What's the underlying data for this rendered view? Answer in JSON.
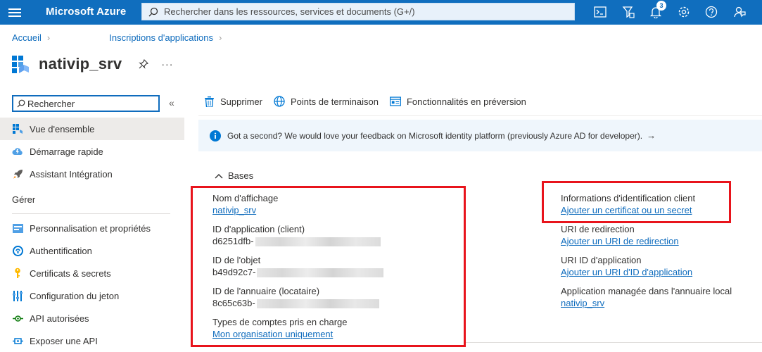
{
  "topbar": {
    "brand": "Microsoft Azure",
    "search_placeholder": "Rechercher dans les ressources, services et documents (G+/)",
    "notification_count": "3",
    "icons": [
      "cloud-shell-icon",
      "directory-filter-icon",
      "notifications-icon",
      "settings-icon",
      "help-icon",
      "feedback-icon"
    ]
  },
  "breadcrumb": {
    "home": "Accueil",
    "parent": "Inscriptions d'applications"
  },
  "header": {
    "title": "nativip_srv",
    "more": "···"
  },
  "sidebar": {
    "search_placeholder": "Rechercher",
    "collapse": "«",
    "items": [
      {
        "label": "Vue d'ensemble",
        "icon": "overview-grid-icon"
      },
      {
        "label": "Démarrage rapide",
        "icon": "quickstart-cloud-icon"
      },
      {
        "label": "Assistant Intégration",
        "icon": "rocket-icon"
      }
    ],
    "section_label": "Gérer",
    "manage_items": [
      {
        "label": "Personnalisation et propriétés",
        "icon": "branding-icon"
      },
      {
        "label": "Authentification",
        "icon": "authentication-icon"
      },
      {
        "label": "Certificats & secrets",
        "icon": "key-icon"
      },
      {
        "label": "Configuration du jeton",
        "icon": "token-config-icon"
      },
      {
        "label": "API autorisées",
        "icon": "api-permissions-icon"
      },
      {
        "label": "Exposer une API",
        "icon": "expose-api-icon"
      }
    ]
  },
  "toolbar": {
    "delete_label": "Supprimer",
    "endpoints_label": "Points de terminaison",
    "preview_label": "Fonctionnalités en préversion"
  },
  "banner": {
    "text": "Got a second? We would love your feedback on Microsoft identity platform (previously Azure AD for developer).",
    "arrow": "→"
  },
  "essentials": {
    "section_label": "Bases",
    "left": {
      "display_name_label": "Nom d'affichage",
      "display_name_value": "nativip_srv",
      "app_id_label": "ID d'application (client)",
      "app_id_value": "d6251dfb-",
      "object_id_label": "ID de l'objet",
      "object_id_value": "b49d92c7-",
      "tenant_id_label": "ID de l'annuaire (locataire)",
      "tenant_id_value": "8c65c63b-",
      "account_types_label": "Types de comptes pris en charge",
      "account_types_value": "Mon organisation uniquement"
    },
    "right": {
      "client_credentials_label": "Informations d'identification client",
      "client_credentials_link": "Ajouter un certificat ou un secret",
      "redirect_uri_label": "URI de redirection",
      "redirect_uri_link": "Ajouter un URI de redirection",
      "app_id_uri_label": "URI ID d'application",
      "app_id_uri_link": "Ajouter un URI d'ID d'application",
      "managed_app_label": "Application managée dans l'annuaire local",
      "managed_app_link": "nativip_srv"
    }
  },
  "colors": {
    "topbar": "#106ebe",
    "link": "#0f6cbd",
    "highlight_box": "#e8141c",
    "banner_bg": "#eff6fc"
  }
}
